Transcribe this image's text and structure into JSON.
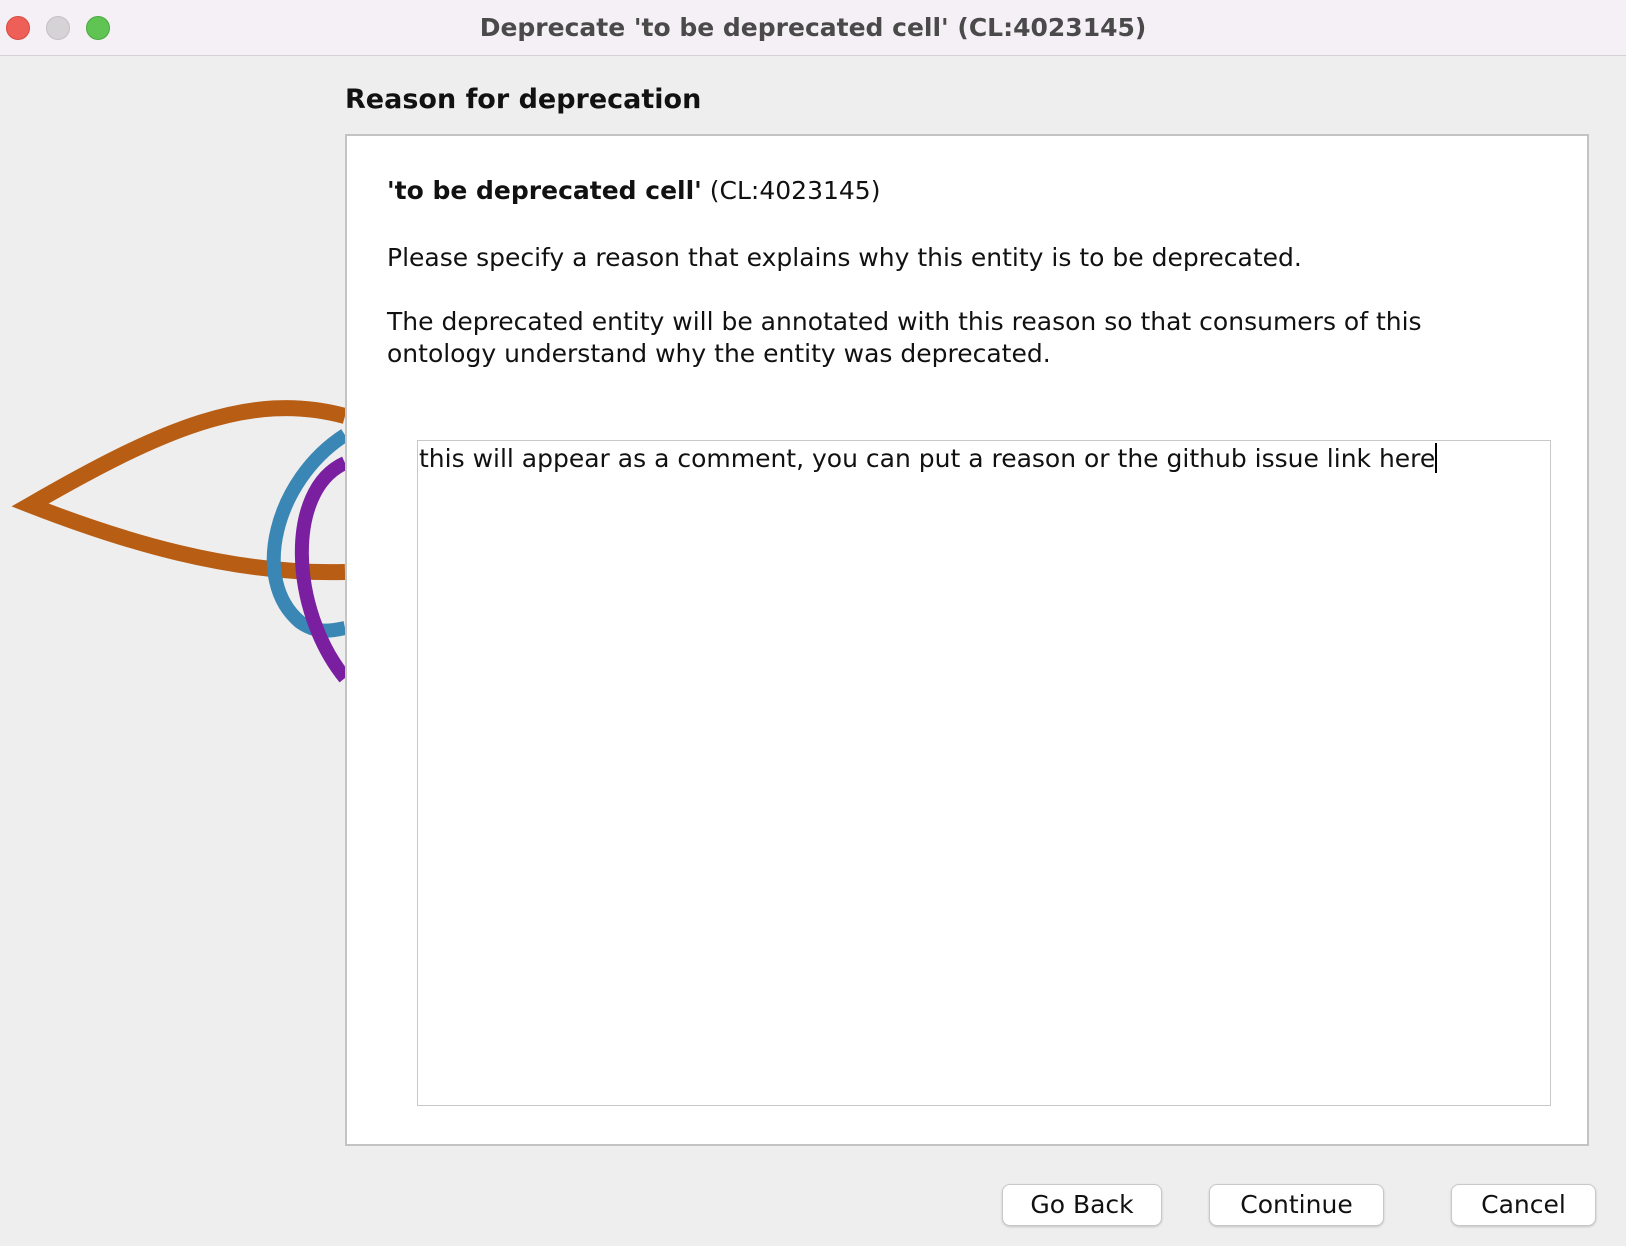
{
  "window": {
    "title": "Deprecate 'to be deprecated cell' (CL:4023145)"
  },
  "section": {
    "heading": "Reason for deprecation"
  },
  "entity": {
    "label": "'to be deprecated cell'",
    "id": " (CL:4023145)"
  },
  "instructions": {
    "paragraph1": "Please specify a reason that explains why this entity is to be deprecated.",
    "paragraph2": "The deprecated entity will be annotated with this reason so that consumers of this ontology understand why the entity was deprecated."
  },
  "reason_field": {
    "value": "this will appear as a comment, you can put a reason or the github issue link here"
  },
  "buttons": {
    "go_back": "Go Back",
    "continue": "Continue",
    "cancel": "Cancel"
  },
  "logo": {
    "icon": "protege-logo",
    "colors": {
      "orange": "#b85d14",
      "blue": "#3a87b5",
      "purple": "#7a1fa0"
    }
  }
}
